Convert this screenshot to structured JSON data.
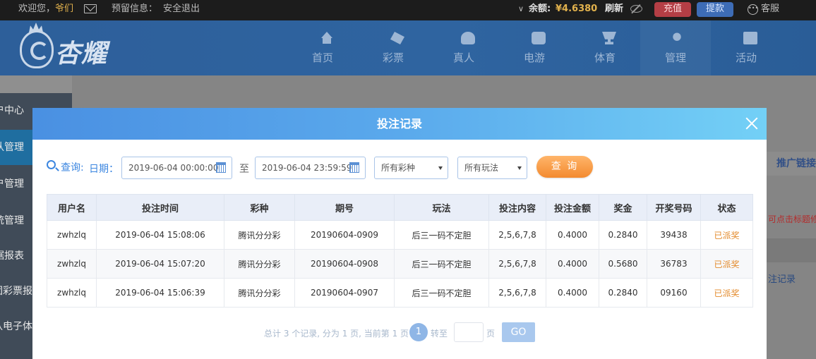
{
  "topbar": {
    "welcome": "欢迎您，",
    "username": "爷们",
    "reserve_label": "预留信息：",
    "logout": "安全退出",
    "balance_label": "余额:",
    "balance_value": "¥4.6380",
    "refresh": "刷新",
    "recharge": "充值",
    "withdraw": "提款",
    "service": "客服"
  },
  "header": {
    "logo_text": "杏耀",
    "nav": [
      {
        "label": "首页",
        "icon": "home-icon"
      },
      {
        "label": "彩票",
        "icon": "lottery-icon"
      },
      {
        "label": "真人",
        "icon": "live-dealer-icon"
      },
      {
        "label": "电游",
        "icon": "slot-game-icon"
      },
      {
        "label": "体育",
        "icon": "trophy-icon"
      },
      {
        "label": "管理",
        "icon": "users-icon"
      },
      {
        "label": "活动",
        "icon": "gift-icon"
      }
    ]
  },
  "sidebar": {
    "items": [
      "户中心",
      "队管理",
      "户管理",
      "统管理",
      "据报表",
      "团彩票报",
      "队电子体"
    ]
  },
  "background": {
    "promo_link": "推广链接",
    "red_hint": "可点击标题修改",
    "record_link": "注记录"
  },
  "modal": {
    "title": "投注记录",
    "search": {
      "query_label": "查询:",
      "date_label": "日期：",
      "start_date": "2019-06-04 00:00:00",
      "to_label": "至",
      "end_date": "2019-06-04 23:59:59",
      "lottery_select": "所有彩种",
      "play_select": "所有玩法",
      "query_button": "查 询"
    },
    "table": {
      "headers": [
        "用户名",
        "投注时间",
        "彩种",
        "期号",
        "玩法",
        "投注内容",
        "投注金额",
        "奖金",
        "开奖号码",
        "状态"
      ],
      "rows": [
        [
          "zwhzlq",
          "2019-06-04 15:08:06",
          "腾讯分分彩",
          "20190604-0909",
          "后三一码不定胆",
          "2,5,6,7,8",
          "0.4000",
          "0.2840",
          "39438",
          "已派奖"
        ],
        [
          "zwhzlq",
          "2019-06-04 15:07:20",
          "腾讯分分彩",
          "20190604-0908",
          "后三一码不定胆",
          "2,5,6,7,8",
          "0.4000",
          "0.5680",
          "36783",
          "已派奖"
        ],
        [
          "zwhzlq",
          "2019-06-04 15:06:39",
          "腾讯分分彩",
          "20190604-0907",
          "后三一码不定胆",
          "2,5,6,7,8",
          "0.4000",
          "0.2840",
          "09160",
          "已派奖"
        ]
      ]
    },
    "pager": {
      "summary": "总计 3 个记录, 分为 1 页, 当前第 1 页",
      "current_page": "1",
      "goto_label": "转至",
      "page_unit": "页",
      "go_button": "GO"
    }
  }
}
